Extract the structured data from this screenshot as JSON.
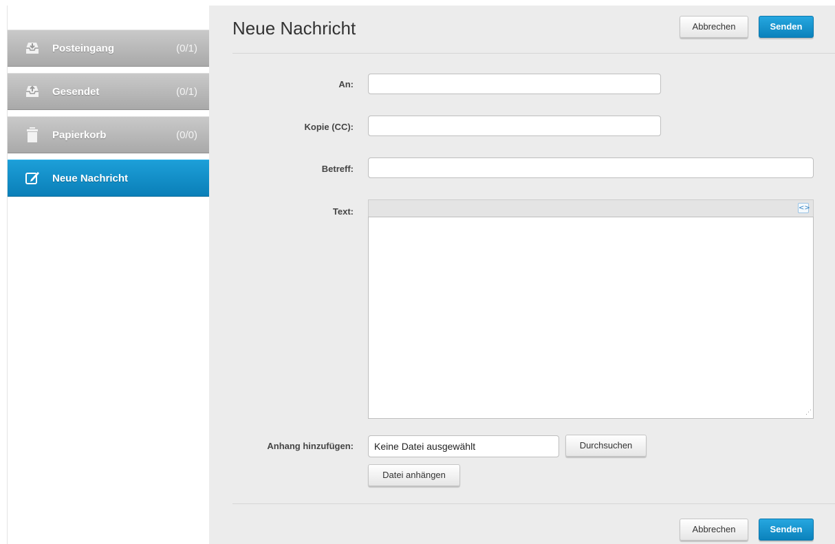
{
  "sidebar": {
    "items": [
      {
        "label": "Posteingang",
        "count": "(0/1)",
        "icon": "inbox-icon"
      },
      {
        "label": "Gesendet",
        "count": "(0/1)",
        "icon": "sent-icon"
      },
      {
        "label": "Papierkorb",
        "count": "(0/0)",
        "icon": "trash-icon"
      },
      {
        "label": "Neue Nachricht",
        "count": "",
        "icon": "compose-icon",
        "active": true
      }
    ]
  },
  "header": {
    "title": "Neue Nachricht",
    "cancel_label": "Abbrechen",
    "send_label": "Senden"
  },
  "form": {
    "to_label": "An:",
    "to_value": "",
    "cc_label": "Kopie (CC):",
    "cc_value": "",
    "subject_label": "Betreff:",
    "subject_value": "",
    "text_label": "Text:",
    "text_value": "",
    "attachment_label": "Anhang hinzufügen:",
    "file_status": "Keine Datei ausgewählt",
    "browse_label": "Durchsuchen",
    "attach_label": "Datei anhängen"
  },
  "footer": {
    "cancel_label": "Abbrechen",
    "send_label": "Senden"
  },
  "colors": {
    "accent": "#0b82bc",
    "sidebar_gray": "#b5b5b5",
    "main_bg": "#ececec"
  }
}
